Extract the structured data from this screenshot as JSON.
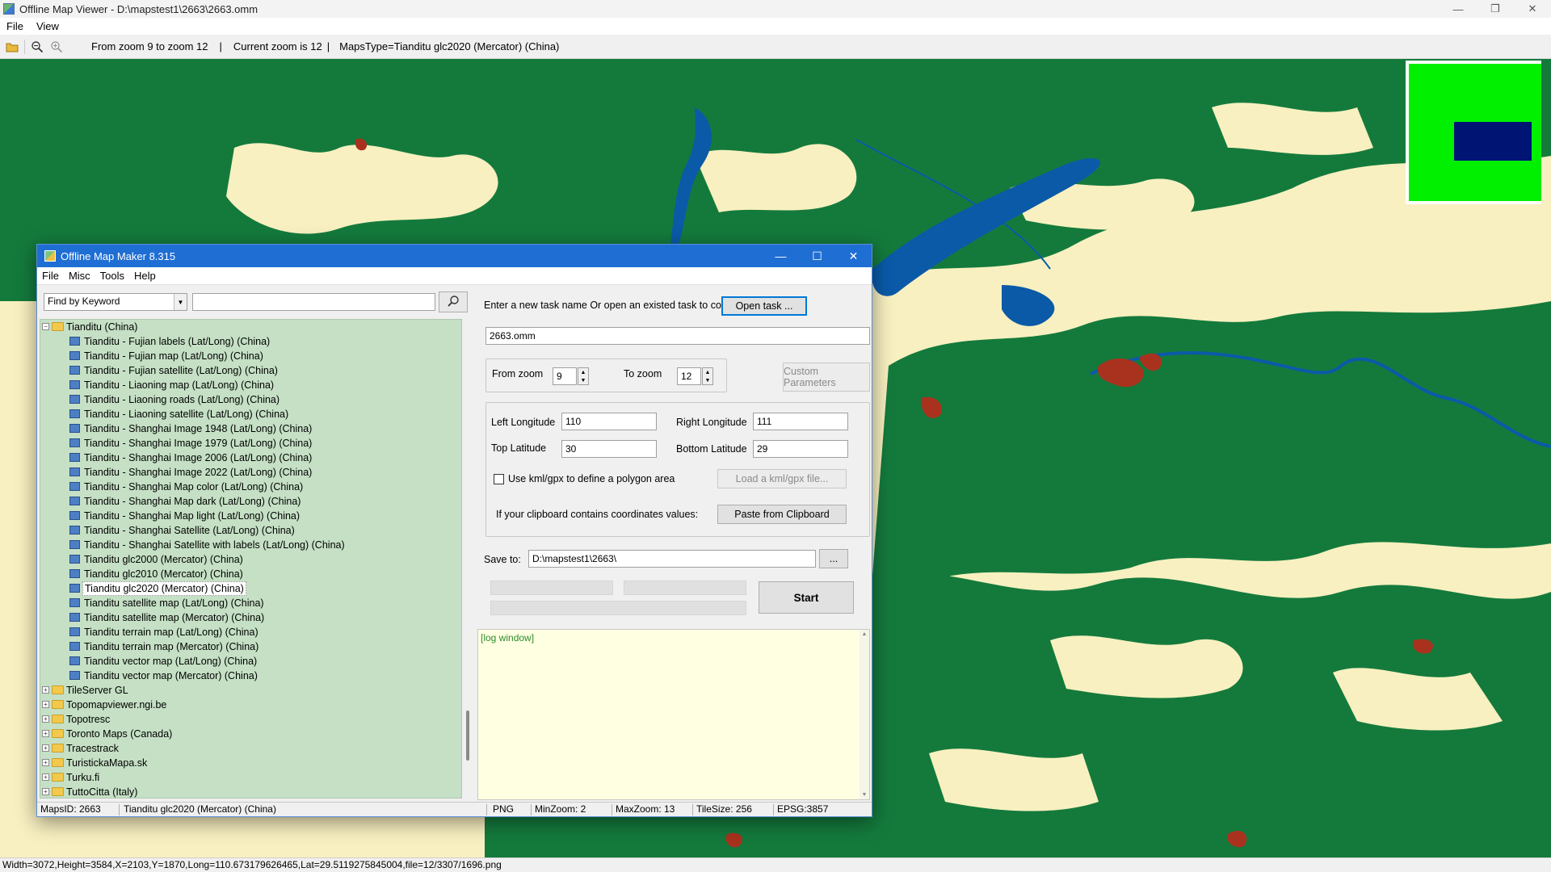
{
  "window": {
    "title": "Offline Map Viewer - D:\\mapstest1\\2663\\2663.omm",
    "controls": [
      "—",
      "❐",
      "✕"
    ]
  },
  "menu": [
    "File",
    "View"
  ],
  "toolbar": {
    "zoom_range": "From zoom 9 to zoom 12",
    "current_zoom": "Current zoom is 12",
    "maps_type": "MapsType=Tianditu glc2020 (Mercator) (China)",
    "divider": "|"
  },
  "statusbar": {
    "text": "Width=3072,Height=3584,X=2103,Y=1870,Long=110.673179626465,Lat=29.5119275845004,file=12/3307/1696.png"
  },
  "map_colors": {
    "forest": "#147a3c",
    "cropland": "#f8f0c0",
    "water": "#0a5aa8",
    "urban": "#a8321e",
    "overview_bg": "#00f000",
    "overview_view": "#001473"
  },
  "dialog": {
    "title": "Offline Map Maker 8.315",
    "controls": [
      "—",
      "☐",
      "✕"
    ],
    "menu": [
      "File",
      "Misc",
      "Tools",
      "Help"
    ],
    "find_mode": "Find by Keyword",
    "search_value": "",
    "tree": {
      "root": "Tianditu (China)",
      "children": [
        "Tianditu - Fujian labels (Lat/Long) (China)",
        "Tianditu - Fujian map (Lat/Long) (China)",
        "Tianditu - Fujian satellite (Lat/Long) (China)",
        "Tianditu - Liaoning map (Lat/Long) (China)",
        "Tianditu - Liaoning roads (Lat/Long) (China)",
        "Tianditu - Liaoning satellite (Lat/Long) (China)",
        "Tianditu - Shanghai Image 1948 (Lat/Long) (China)",
        "Tianditu - Shanghai Image 1979 (Lat/Long) (China)",
        "Tianditu - Shanghai Image 2006 (Lat/Long) (China)",
        "Tianditu - Shanghai Image 2022 (Lat/Long) (China)",
        "Tianditu - Shanghai Map color (Lat/Long) (China)",
        "Tianditu - Shanghai Map dark (Lat/Long) (China)",
        "Tianditu - Shanghai Map light (Lat/Long) (China)",
        "Tianditu - Shanghai Satellite (Lat/Long) (China)",
        "Tianditu - Shanghai Satellite with labels (Lat/Long) (China)",
        "Tianditu glc2000 (Mercator) (China)",
        "Tianditu glc2010 (Mercator) (China)",
        "Tianditu glc2020 (Mercator) (China)",
        "Tianditu satellite map (Lat/Long) (China)",
        "Tianditu satellite map (Mercator) (China)",
        "Tianditu terrain map (Lat/Long) (China)",
        "Tianditu terrain map (Mercator) (China)",
        "Tianditu vector map (Lat/Long) (China)",
        "Tianditu vector map (Mercator) (China)"
      ],
      "selected": "Tianditu glc2020 (Mercator) (China)",
      "siblings": [
        "TileServer GL",
        "Topomapviewer.ngi.be",
        "Topotresc",
        "Toronto Maps (Canada)",
        "Tracestrack",
        "TuristickaMapa.sk",
        "Turku.fi",
        "TuttoCitta (Italy)"
      ]
    },
    "task_prompt": "Enter a new task name Or open an existed task to continue:",
    "open_task_label": "Open task ...",
    "task_name": "2663.omm",
    "from_zoom_label": "From zoom",
    "from_zoom": "9",
    "to_zoom_label": "To zoom",
    "to_zoom": "12",
    "custom_params_label": "Custom Parameters",
    "left_lon_label": "Left Longitude",
    "left_lon": "110",
    "right_lon_label": "Right Longitude",
    "right_lon": "111",
    "top_lat_label": "Top Latitude",
    "top_lat": "30",
    "bottom_lat_label": "Bottom Latitude",
    "bottom_lat": "29",
    "kml_label": "Use kml/gpx to define a polygon area",
    "kml_button": "Load a kml/gpx file...",
    "clipboard_label": "If your clipboard contains coordinates values:",
    "clipboard_button": "Paste from Clipboard",
    "save_to_label": "Save to:",
    "save_path": "D:\\mapstest1\\2663\\",
    "browse_label": "...",
    "start_label": "Start",
    "log_text": "[log window]",
    "status": {
      "maps_id": "MapsID: 2663",
      "map_name": "Tianditu glc2020 (Mercator) (China)",
      "format": "PNG",
      "min_zoom": "MinZoom: 2",
      "max_zoom": "MaxZoom: 13",
      "tile_size": "TileSize: 256",
      "epsg": "EPSG:3857"
    }
  }
}
